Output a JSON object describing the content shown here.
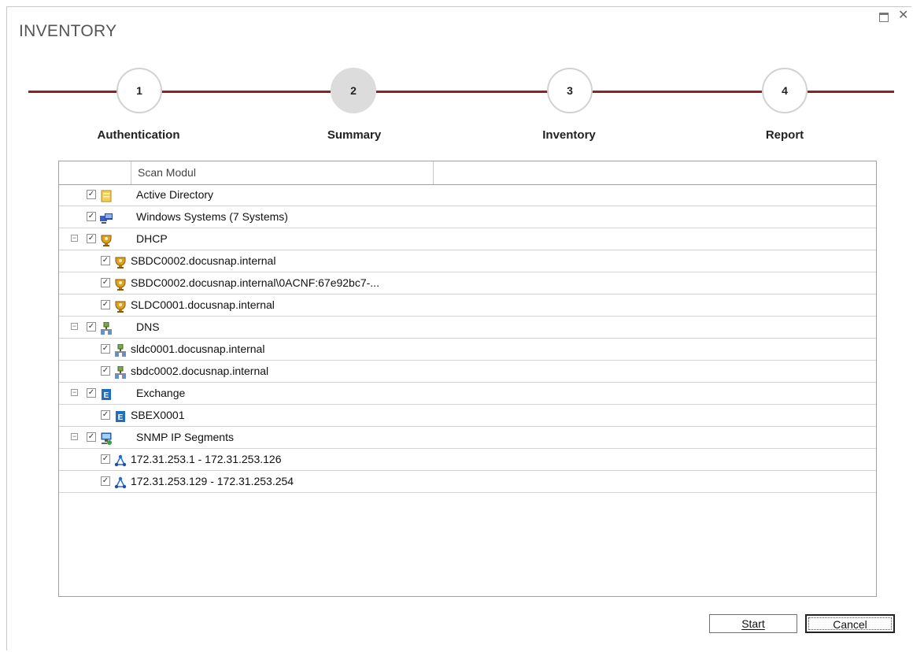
{
  "window": {
    "title": "INVENTORY"
  },
  "steps": [
    {
      "number": "1",
      "label": "Authentication"
    },
    {
      "number": "2",
      "label": "Summary"
    },
    {
      "number": "3",
      "label": "Inventory"
    },
    {
      "number": "4",
      "label": "Report"
    }
  ],
  "grid": {
    "columns": [
      "Scan Modul"
    ],
    "rows": [
      {
        "label": "Active Directory",
        "checked": true,
        "icon": "active-directory-icon"
      },
      {
        "label": "Windows Systems (7 Systems)",
        "checked": true,
        "icon": "windows-systems-icon"
      },
      {
        "label": "DHCP",
        "checked": true,
        "icon": "dhcp-icon",
        "expander": "minus"
      },
      {
        "label": "SBDC0002.docusnap.internal",
        "checked": true,
        "icon": "dhcp-icon"
      },
      {
        "label": "SBDC0002.docusnap.internal\\0ACNF:67e92bc7-...",
        "checked": true,
        "icon": "dhcp-icon"
      },
      {
        "label": "SLDC0001.docusnap.internal",
        "checked": true,
        "icon": "dhcp-icon"
      },
      {
        "label": "DNS",
        "checked": true,
        "icon": "dns-icon",
        "expander": "minus"
      },
      {
        "label": "sldc0001.docusnap.internal",
        "checked": true,
        "icon": "dns-icon"
      },
      {
        "label": "sbdc0002.docusnap.internal",
        "checked": true,
        "icon": "dns-icon"
      },
      {
        "label": "Exchange",
        "checked": true,
        "icon": "exchange-icon",
        "expander": "minus"
      },
      {
        "label": "SBEX0001",
        "checked": true,
        "icon": "exchange-icon"
      },
      {
        "label": "SNMP IP Segments",
        "checked": true,
        "icon": "snmp-icon",
        "expander": "minus"
      },
      {
        "label": "172.31.253.1 - 172.31.253.126",
        "checked": true,
        "icon": "ip-segment-icon"
      },
      {
        "label": "172.31.253.129 - 172.31.253.254",
        "checked": true,
        "icon": "ip-segment-icon"
      }
    ]
  },
  "buttons": {
    "start": "Start",
    "cancel": "Cancel"
  },
  "colors": {
    "accent": "#8b2225",
    "active_step": "#dcdcdc"
  }
}
